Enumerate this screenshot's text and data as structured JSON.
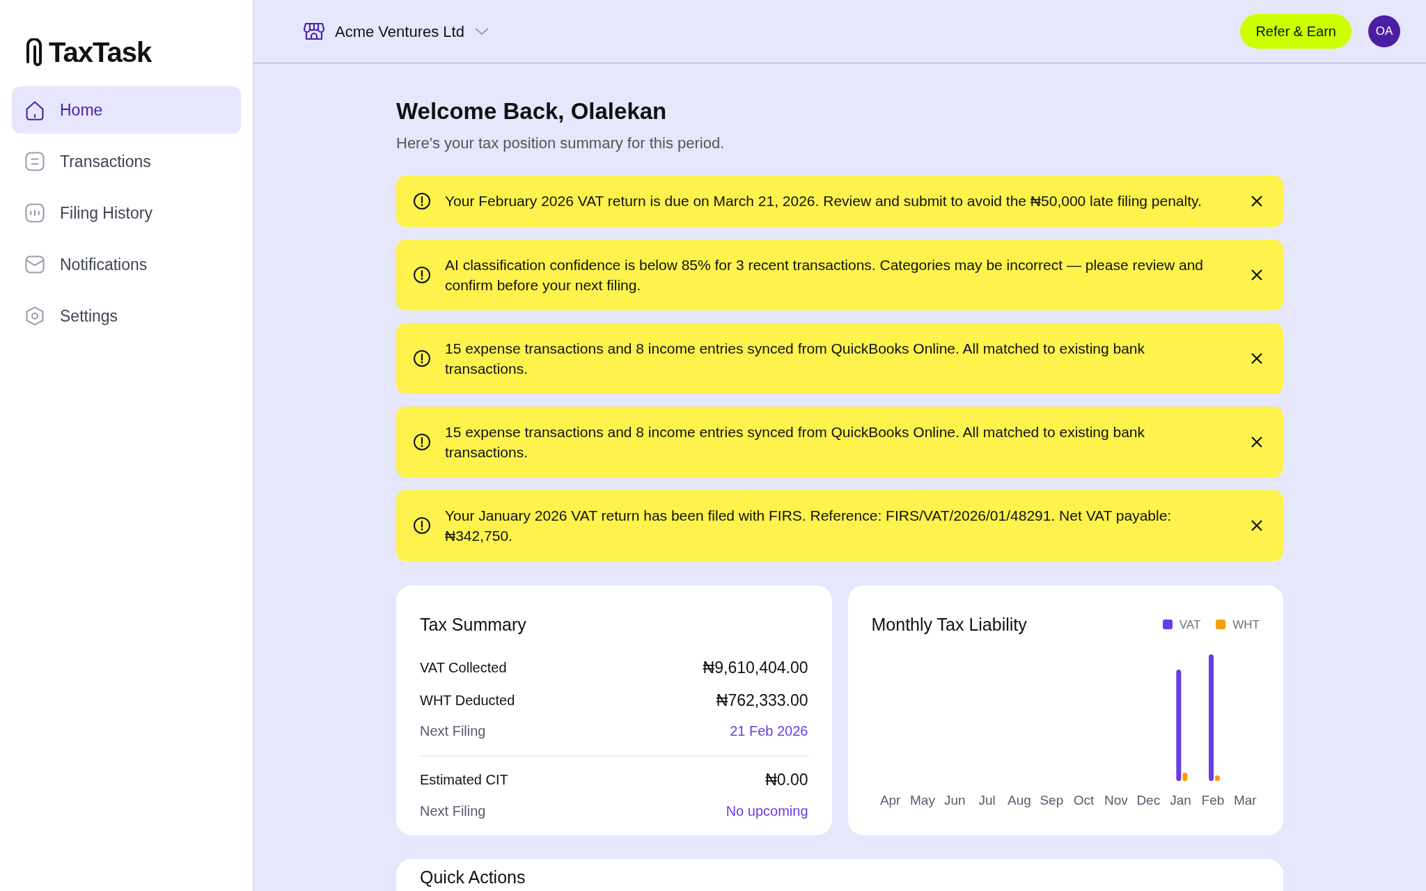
{
  "brand": {
    "name": "TaxTask"
  },
  "sidebar": {
    "items": [
      {
        "label": "Home",
        "selected": true
      },
      {
        "label": "Transactions",
        "selected": false
      },
      {
        "label": "Filing History",
        "selected": false
      },
      {
        "label": "Notifications",
        "selected": false
      },
      {
        "label": "Settings",
        "selected": false
      }
    ]
  },
  "header": {
    "business": "Acme Ventures Ltd",
    "refer_button": "Refer & Earn",
    "avatar": "OA"
  },
  "welcome": {
    "title": "Welcome Back, Olalekan",
    "subtitle": "Here's your tax position summary for this period."
  },
  "alerts": [
    {
      "text": "Your February 2026 VAT return is due on March 21, 2026. Review and submit to avoid the ₦50,000 late filing penalty."
    },
    {
      "text": "AI classification confidence is below 85% for 3 recent transactions. Categories may be incorrect — please review and confirm before your next filing."
    },
    {
      "text": "15 expense transactions and 8 income entries synced from QuickBooks Online. All matched to existing bank transactions."
    },
    {
      "text": "15 expense transactions and 8 income entries synced from QuickBooks Online. All matched to existing bank transactions."
    },
    {
      "text": "Your January 2026 VAT return has been filed with FIRS. Reference: FIRS/VAT/2026/01/48291. Net VAT payable: ₦342,750."
    }
  ],
  "tax_summary": {
    "title": "Tax Summary",
    "groups": [
      {
        "rows": [
          {
            "label": "VAT Collected",
            "value": "₦9,610,404.00",
            "kind": "amount"
          },
          {
            "label": "WHT Deducted",
            "value": "₦762,333.00",
            "kind": "amount"
          },
          {
            "label": "Next Filing",
            "value": "21 Feb 2026",
            "kind": "date"
          }
        ]
      },
      {
        "rows": [
          {
            "label": "Estimated CIT",
            "value": "₦0.00",
            "kind": "amount"
          },
          {
            "label": "Next Filing",
            "value": "No upcoming",
            "kind": "date"
          }
        ]
      }
    ]
  },
  "liability_chart": {
    "title": "Monthly Tax Liability",
    "legend": [
      {
        "label": "VAT",
        "color": "#6a3ce6"
      },
      {
        "label": "WHT",
        "color": "#f59e0b"
      }
    ],
    "months": [
      "Apr",
      "May",
      "Jun",
      "Jul",
      "Aug",
      "Sep",
      "Oct",
      "Nov",
      "Dec",
      "Jan",
      "Feb",
      "Mar"
    ]
  },
  "quick_actions": {
    "title": "Quick Actions"
  }
}
